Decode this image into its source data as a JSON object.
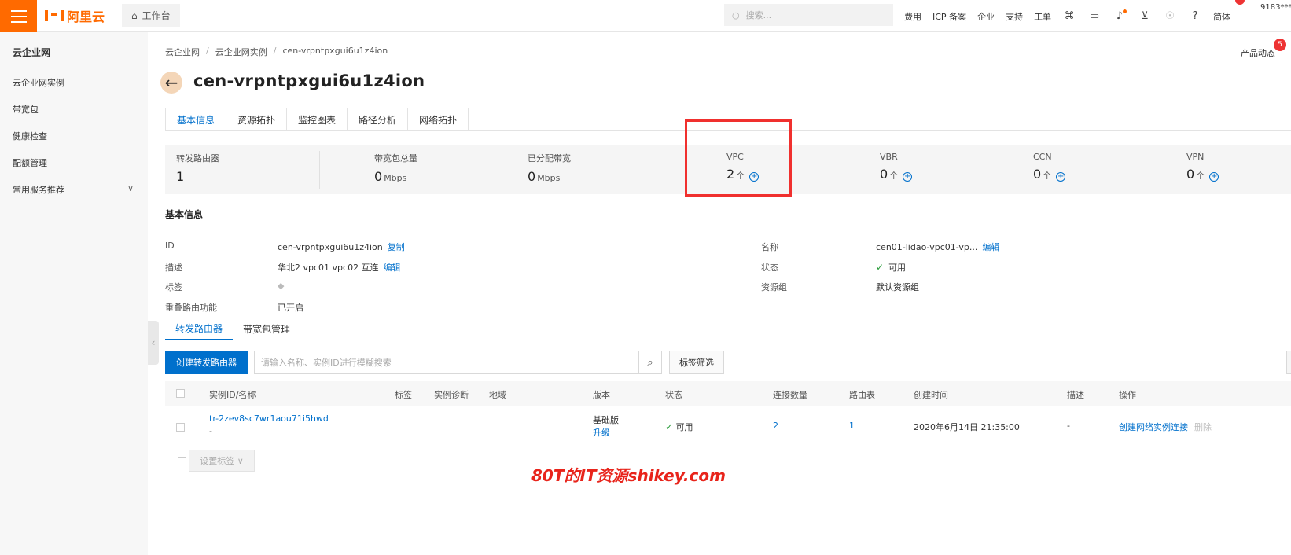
{
  "topbar": {
    "logo_text": "阿里云",
    "workbench": "工作台",
    "search_placeholder": "搜索...",
    "nav": [
      "费用",
      "ICP 备案",
      "企业",
      "支持",
      "工单"
    ],
    "lang": "简体",
    "user": "9183***"
  },
  "sidebar": {
    "title": "云企业网",
    "items": [
      "云企业网实例",
      "带宽包",
      "健康检查",
      "配额管理",
      "常用服务推荐"
    ]
  },
  "breadcrumb": [
    "云企业网",
    "云企业网实例",
    "cen-vrpntpxgui6u1z4ion"
  ],
  "product_news": {
    "label": "产品动态",
    "badge": "5"
  },
  "page_title": "cen-vrpntpxgui6u1z4ion",
  "tabs": [
    "基本信息",
    "资源拓扑",
    "监控图表",
    "路径分析",
    "网络拓扑"
  ],
  "stats": [
    {
      "label": "转发路由器",
      "value": "1",
      "unit": ""
    },
    {
      "label": "带宽包总量",
      "value": "0",
      "unit": "Mbps"
    },
    {
      "label": "已分配带宽",
      "value": "0",
      "unit": "Mbps"
    },
    {
      "label": "VPC",
      "value": "2",
      "unit": "个"
    },
    {
      "label": "VBR",
      "value": "0",
      "unit": "个"
    },
    {
      "label": "CCN",
      "value": "0",
      "unit": "个"
    },
    {
      "label": "VPN",
      "value": "0",
      "unit": "个"
    }
  ],
  "basic_info": {
    "title": "基本信息",
    "id_label": "ID",
    "id_value": "cen-vrpntpxgui6u1z4ion",
    "copy": "复制",
    "desc_label": "描述",
    "desc_value": "华北2 vpc01 vpc02 互连",
    "edit": "编辑",
    "tag_label": "标签",
    "overlap_label": "重叠路由功能",
    "overlap_value": "已开启",
    "name_label": "名称",
    "name_value": "cen01-lidao-vpc01-vp...",
    "status_label": "状态",
    "status_value": "可用",
    "rg_label": "资源组",
    "rg_value": "默认资源组"
  },
  "subtabs": [
    "转发路由器",
    "带宽包管理"
  ],
  "toolbar": {
    "create": "创建转发路由器",
    "search_placeholder": "请输入名称、实例ID进行模糊搜索",
    "filter": "标签筛选"
  },
  "table": {
    "headers": [
      "实例ID/名称",
      "标签",
      "实例诊断",
      "地域",
      "版本",
      "状态",
      "连接数量",
      "路由表",
      "创建时间",
      "描述",
      "操作"
    ],
    "row": {
      "id": "tr-2zev8sc7wr1aou71i5hwd",
      "name": "-",
      "version": "基础版",
      "upgrade": "升级",
      "status": "可用",
      "connections": "2",
      "route_tables": "1",
      "created": "2020年6月14日 21:35:00",
      "desc": "-",
      "action_create": "创建网络实例连接",
      "action_delete": "删除"
    }
  },
  "set_tag": "设置标签",
  "watermark": "80T的IT资源shikey.com"
}
